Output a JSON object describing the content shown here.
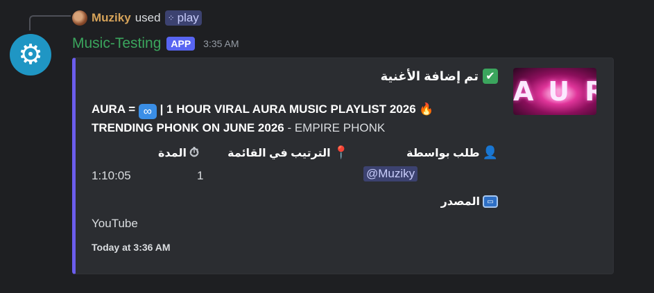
{
  "command": {
    "user": "Muziky",
    "verb": "used",
    "command_name": "play"
  },
  "message": {
    "author": "Music-Testing",
    "badge": "APP",
    "time": "3:35 AM"
  },
  "embed": {
    "accent_color": "#6b5dec",
    "title": "تم إضافة الأغنية",
    "desc_part1": "AURA = ",
    "desc_part2": " | 1 HOUR VIRAL AURA MUSIC PLAYLIST 2026 ",
    "desc_line2_bold": "TRENDING PHONK ON JUNE 2026",
    "desc_line2_rest": " - EMPIRE PHONK",
    "thumbnail_text": "AURA",
    "fields": {
      "requested_by": {
        "name": "طلب بواسطة",
        "value": "@Muziky",
        "icon": "user-icon"
      },
      "queue_position": {
        "name": "الترتيب في القائمة",
        "value": "1",
        "icon": "pin-icon"
      },
      "duration": {
        "name": "المدة",
        "value": "1:10:05",
        "icon": "timer-icon"
      },
      "source": {
        "name": "المصدر",
        "value": "YouTube",
        "icon": "tv-icon"
      }
    },
    "footer": "Today at 3:36 AM"
  }
}
